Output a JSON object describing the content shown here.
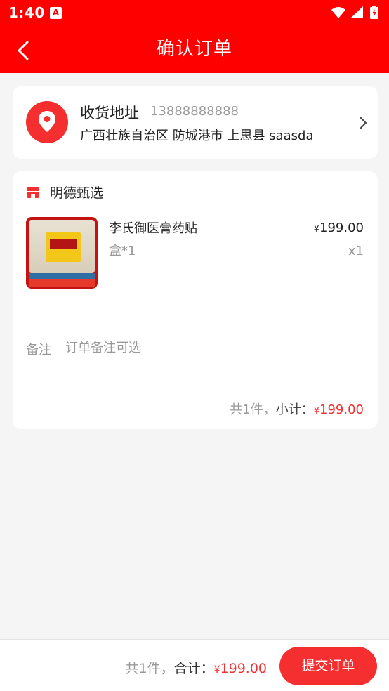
{
  "status_bar": {
    "time": "1:40",
    "notif_icon_letter": "A",
    "icons": [
      "wifi-icon",
      "signal-icon",
      "battery-charging-icon"
    ]
  },
  "nav": {
    "title": "确认订单",
    "back_icon": "chevron-left-icon"
  },
  "address": {
    "label": "收货地址",
    "phone": "13888888888",
    "text": "广西壮族自治区 防城港市 上思县 saasda",
    "icon": "location-pin-icon",
    "chevron_icon": "chevron-right-icon"
  },
  "order": {
    "store_icon": "store-icon",
    "store_name": "明德甄选",
    "product": {
      "name": "李氏御医膏药贴",
      "spec": "盒*1",
      "price_symbol": "¥",
      "price": "199.00",
      "qty": "x1"
    },
    "remark": {
      "label": "备注",
      "placeholder": "订单备注可选"
    },
    "subtotal": {
      "count_text": "共1件，",
      "label": "小计：",
      "symbol": "¥",
      "amount": "199.00"
    }
  },
  "footer": {
    "count_text": "共1件，",
    "total_label": "合计：",
    "symbol": "¥",
    "total_amount": "199.00",
    "submit_label": "提交订单"
  },
  "colors": {
    "brand_red": "#fe0000",
    "accent_red": "#f52f2f",
    "price_red": "#f53030",
    "background": "#f5f5f5"
  }
}
